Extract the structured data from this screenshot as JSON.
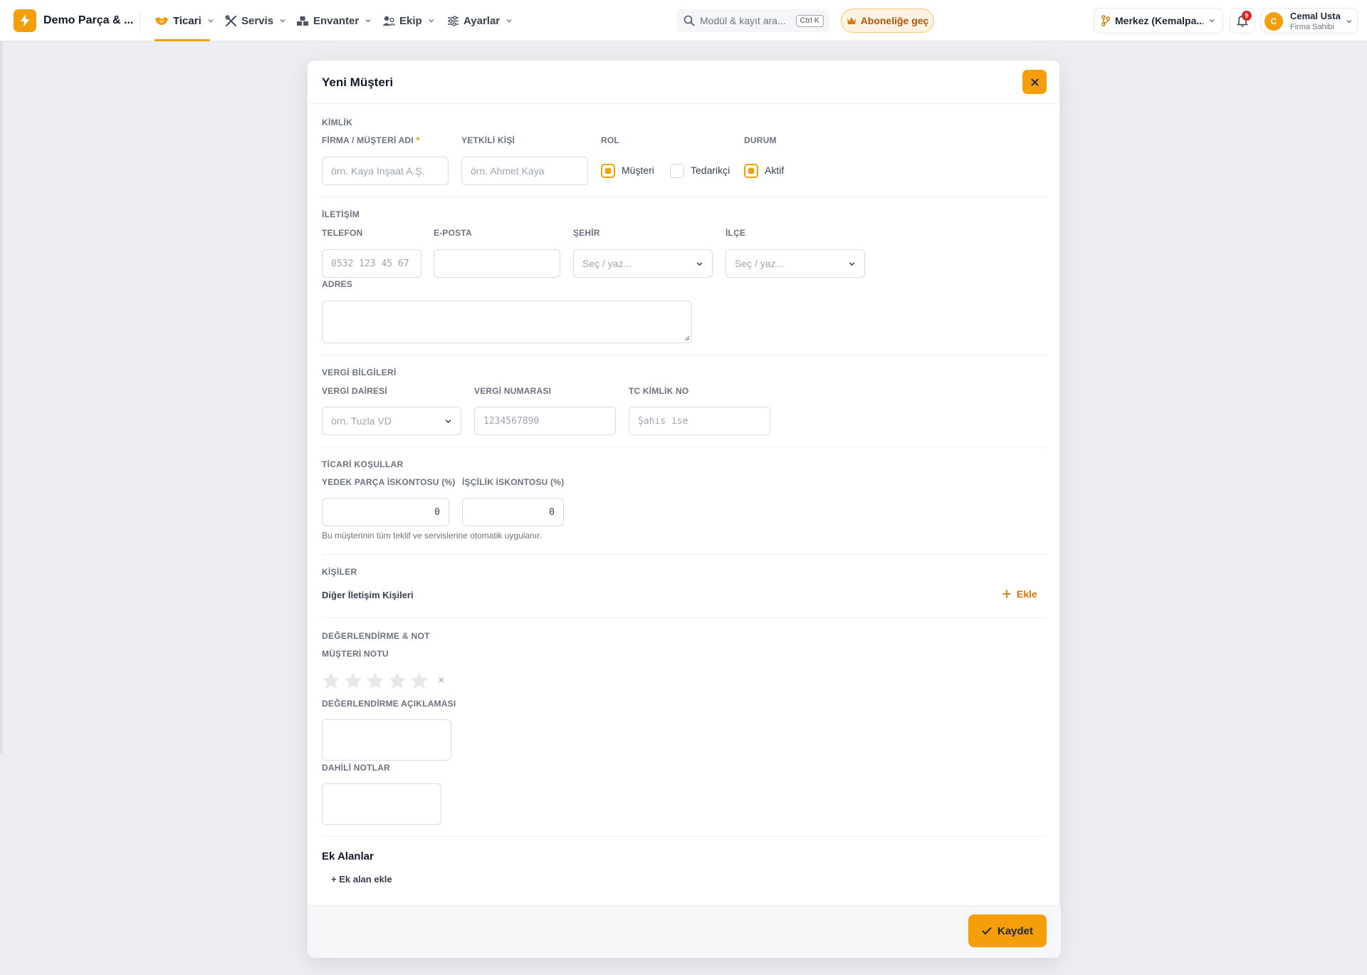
{
  "app": {
    "brand": "Demo Parça & ...",
    "nav": [
      {
        "label": "Ticari"
      },
      {
        "label": "Servis"
      },
      {
        "label": "Envanter"
      },
      {
        "label": "Ekip"
      },
      {
        "label": "Ayarlar"
      }
    ],
    "search": {
      "placeholder": "Modül & kayıt ara...",
      "shortcut": "Ctrl K"
    },
    "subscribe_label": "Aboneliğe geç",
    "branch": "Merkez (Kemalpa...",
    "notifications_count": "9",
    "user": {
      "initial": "C",
      "name": "Cemal Usta",
      "role": "Firma Sahibi"
    },
    "accent": "#f59e0b"
  },
  "modal": {
    "title": "Yeni Müşteri",
    "identity": {
      "section": "KİMLİK",
      "company_label": "FİRMA / MÜŞTERİ ADI",
      "required_mark": "*",
      "company_placeholder": "örn. Kaya İnşaat A.Ş.",
      "contact_label": "YETKİLİ KİŞİ",
      "contact_placeholder": "örn. Ahmet Kaya",
      "role_label": "ROL",
      "role_customer": "Müşteri",
      "role_supplier": "Tedarikçi",
      "status_label": "DURUM",
      "status_active": "Aktif"
    },
    "contact": {
      "section": "İLETİŞİM",
      "phone_label": "TELEFON",
      "phone_placeholder": "0532 123 45 67",
      "email_label": "E-POSTA",
      "city_label": "ŞEHİR",
      "city_placeholder": "Seç / yaz...",
      "district_label": "İLÇE",
      "district_placeholder": "Seç / yaz...",
      "address_label": "ADRES"
    },
    "tax": {
      "section": "VERGİ BİLGİLERİ",
      "office_label": "VERGİ DAİRESİ",
      "office_placeholder": "örn. Tuzla VD",
      "number_label": "VERGİ NUMARASI",
      "number_placeholder": "1234567890",
      "tc_label": "TC KİMLİK NO",
      "tc_placeholder": "Şahıs ise"
    },
    "commercial": {
      "section": "TİCARİ KOŞULLAR",
      "parts_label": "YEDEK PARÇA İSKONTOSU (%)",
      "parts_value": "0",
      "labor_label": "İŞÇİLİK İSKONTOSU (%)",
      "labor_value": "0",
      "hint": "Bu müşterinin tüm teklif ve servislerine otomatik uygulanır."
    },
    "people": {
      "section": "KİŞİLER",
      "subtitle": "Diğer İletişim Kişileri",
      "add_label": "Ekle"
    },
    "rating": {
      "section": "DEĞERLENDİRME & NOT",
      "note_label": "MÜŞTERİ NOTU",
      "stars_value": 0,
      "stars_max": 5,
      "clear_symbol": "×",
      "desc_label": "DEĞERLENDİRME AÇIKLAMASI",
      "internal_label": "DAHİLİ NOTLAR"
    },
    "extra": {
      "title": "Ek Alanlar",
      "add_label": "+ Ek alan ekle"
    },
    "save_label": "Kaydet"
  }
}
